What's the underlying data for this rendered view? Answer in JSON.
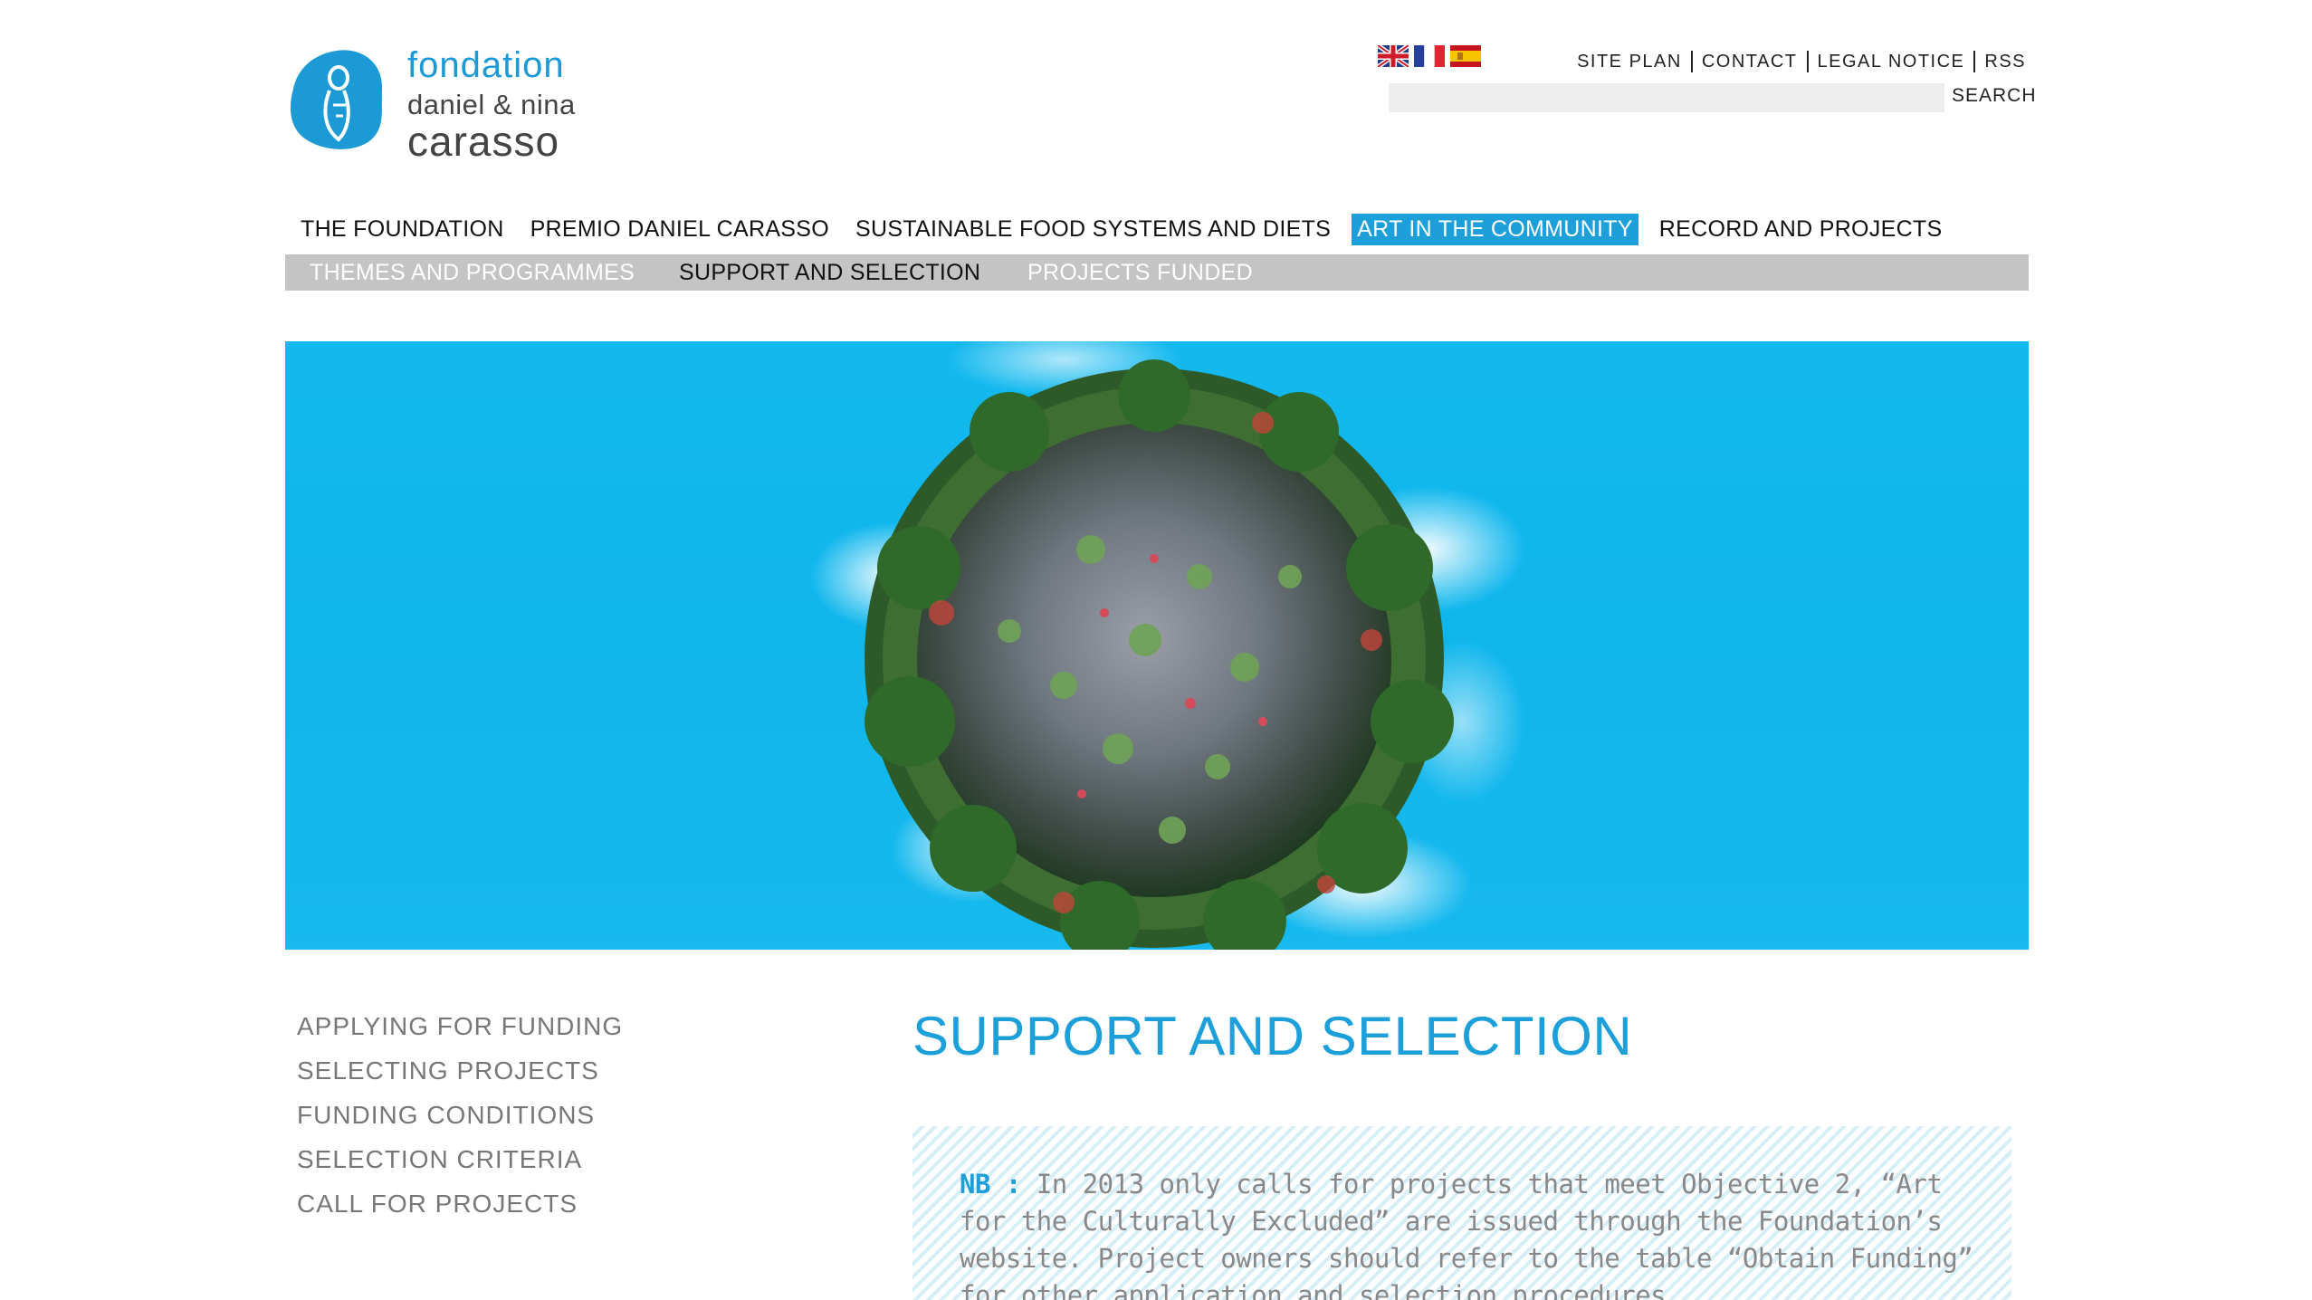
{
  "logo": {
    "line1": "fondation",
    "line2": "daniel & nina",
    "line3": "carasso"
  },
  "languages": [
    {
      "name": "English",
      "icon": "uk-flag-icon"
    },
    {
      "name": "Français",
      "icon": "france-flag-icon"
    },
    {
      "name": "Español",
      "icon": "spain-flag-icon"
    }
  ],
  "utility_nav": [
    "SITE PLAN",
    "CONTACT",
    "LEGAL NOTICE",
    "RSS"
  ],
  "search": {
    "value": "",
    "placeholder": "",
    "button_label": "SEARCH"
  },
  "main_nav": [
    {
      "label": "THE FOUNDATION",
      "active": false
    },
    {
      "label": "PREMIO DANIEL CARASSO",
      "active": false
    },
    {
      "label": "SUSTAINABLE FOOD SYSTEMS AND DIETS",
      "active": false
    },
    {
      "label": "ART IN THE COMMUNITY",
      "active": true
    },
    {
      "label": "RECORD AND PROJECTS",
      "active": false
    }
  ],
  "sub_nav": [
    {
      "label": "THEMES AND PROGRAMMES",
      "current": false
    },
    {
      "label": "SUPPORT AND SELECTION",
      "current": true
    },
    {
      "label": "PROJECTS FUNDED",
      "current": false
    }
  ],
  "side_nav": [
    "APPLYING FOR FUNDING",
    "SELECTING PROJECTS",
    "FUNDING CONDITIONS",
    "SELECTION CRITERIA",
    "CALL FOR PROJECTS"
  ],
  "page_title": "SUPPORT AND SELECTION",
  "notice": {
    "label": "NB :",
    "text": "In 2013 only calls for projects that meet Objective 2, “Art for the Culturally Excluded” are issued through the Foundation’s website. Project owners should refer to the table “Obtain Funding” for other application and selection procedures."
  },
  "colors": {
    "accent": "#1d9fda",
    "subnav_bg": "#c4c4c4",
    "hero_sky": "#12b8ee",
    "side_nav_text": "#777777"
  }
}
